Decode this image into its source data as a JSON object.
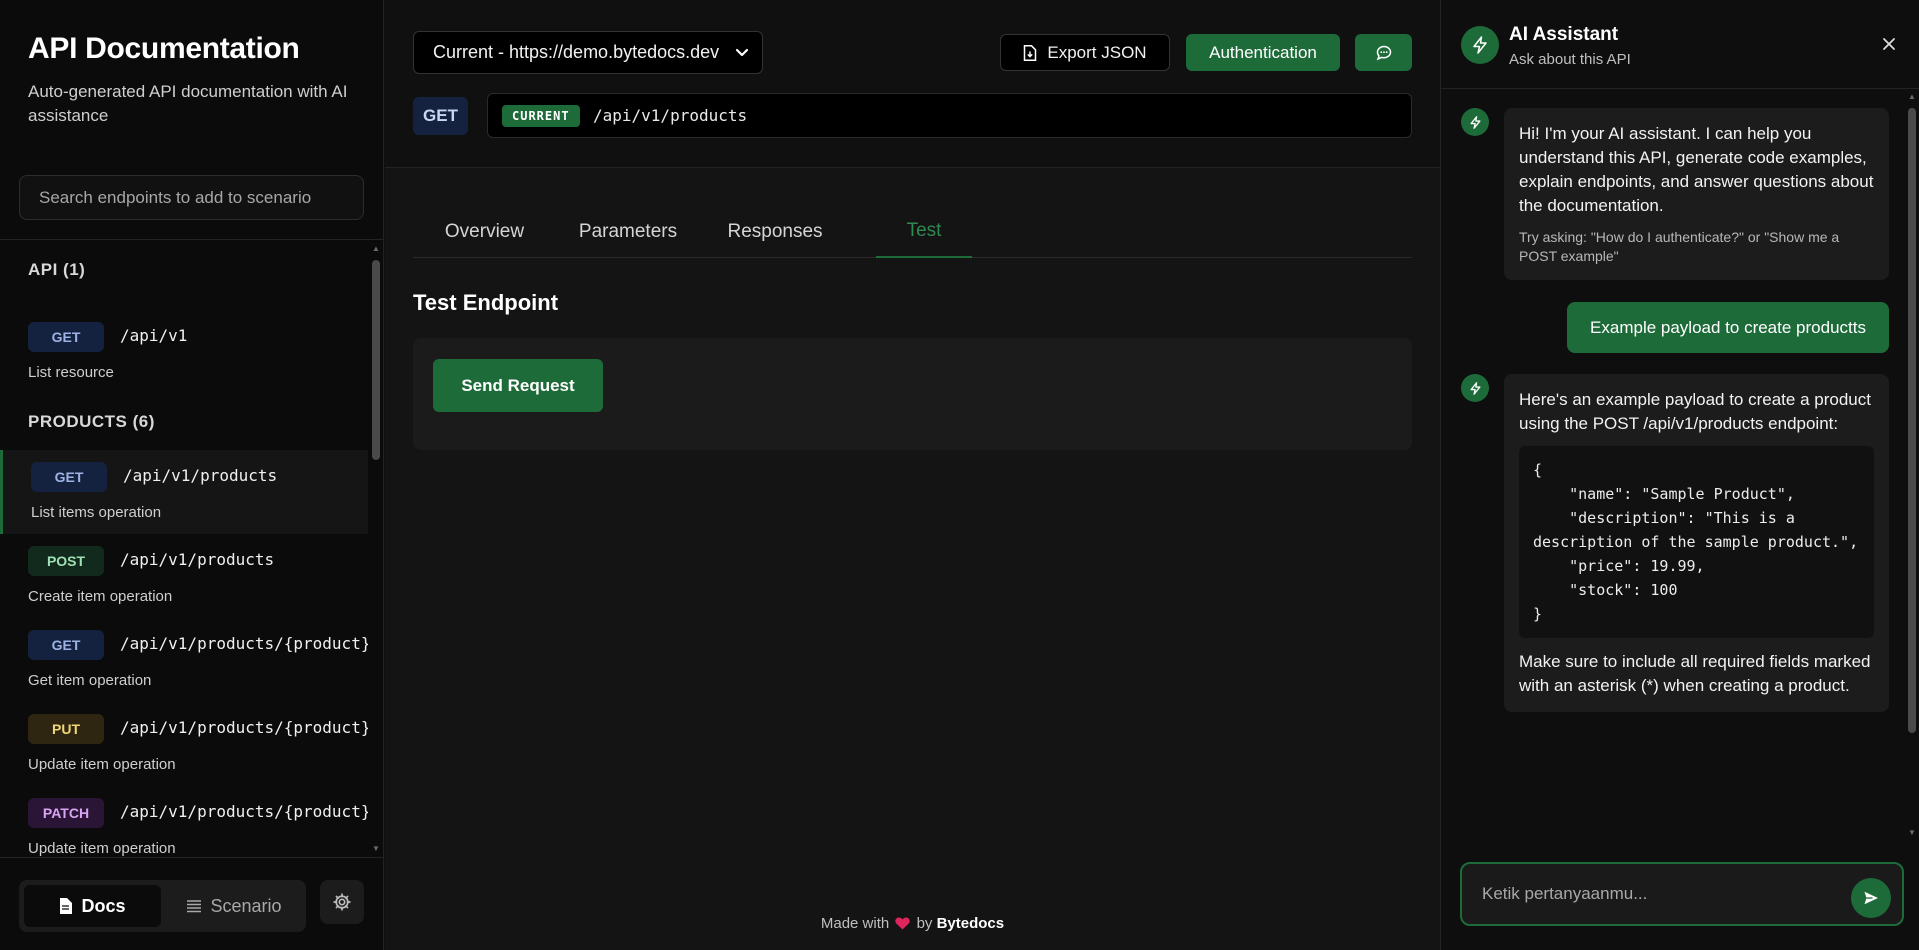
{
  "sidebar": {
    "title": "API Documentation",
    "subtitle": "Auto-generated API documentation with AI assistance",
    "search_placeholder": "Search endpoints to add to scenario",
    "groups": [
      {
        "label": "API (1)"
      },
      {
        "label": "PRODUCTS (6)"
      }
    ],
    "endpoints": [
      {
        "method": "GET",
        "path": "/api/v1",
        "desc": "List resource",
        "active": false
      },
      {
        "method": "GET",
        "path": "/api/v1/products",
        "desc": "List items operation",
        "active": true
      },
      {
        "method": "POST",
        "path": "/api/v1/products",
        "desc": "Create item operation",
        "active": false
      },
      {
        "method": "GET",
        "path": "/api/v1/products/{product}",
        "desc": "Get item operation",
        "active": false
      },
      {
        "method": "PUT",
        "path": "/api/v1/products/{product}",
        "desc": "Update item operation",
        "active": false
      },
      {
        "method": "PATCH",
        "path": "/api/v1/products/{product}",
        "desc": "Update item operation",
        "active": false
      }
    ],
    "footer": {
      "docs_label": "Docs",
      "scenario_label": "Scenario",
      "active_view": "Docs"
    }
  },
  "main": {
    "server_select": "Current - https://demo.bytedocs.dev",
    "export_label": "Export JSON",
    "auth_label": "Authentication",
    "method": "GET",
    "env_badge": "CURRENT",
    "url": "/api/v1/products",
    "tabs": [
      {
        "label": "Overview"
      },
      {
        "label": "Parameters"
      },
      {
        "label": "Responses"
      },
      {
        "label": "Test"
      }
    ],
    "active_tab": "Test",
    "section_title": "Test Endpoint",
    "send_label": "Send Request",
    "footer_prefix": "Made with",
    "footer_by": "by",
    "footer_brand": "Bytedocs"
  },
  "ai": {
    "title": "AI Assistant",
    "subtitle": "Ask about this API",
    "welcome": "Hi! I'm your AI assistant. I can help you understand this API, generate code examples, explain endpoints, and answer questions about the documentation.",
    "hint": "Try asking: \"How do I authenticate?\" or \"Show me a POST example\"",
    "user_message": "Example payload to create productts",
    "reply_intro": "Here's an example payload to create a product using the POST /api/v1/products endpoint:",
    "reply_code": "{\n    \"name\": \"Sample Product\",\n    \"description\": \"This is a description of the sample product.\",\n    \"price\": 19.99,\n    \"stock\": 100\n}",
    "reply_outro": "Make sure to include all required fields marked with an asterisk (*) when creating a product.",
    "input_placeholder": "Ketik pertanyaanmu..."
  },
  "colors": {
    "accent": "#1e6b3a",
    "get": "#14223f",
    "post": "#122a1d",
    "put": "#2e2610",
    "patch": "#2b1536",
    "heart": "#e0245e"
  },
  "icons": {
    "export": "file-download-icon",
    "chat": "chat-bubble-icon",
    "docs": "document-icon",
    "scenario": "list-icon",
    "settings": "gear-icon",
    "assistant": "lightning-icon",
    "close": "close-icon",
    "send": "send-icon",
    "dropdown": "chevron-down-icon",
    "heart": "heart-icon"
  }
}
